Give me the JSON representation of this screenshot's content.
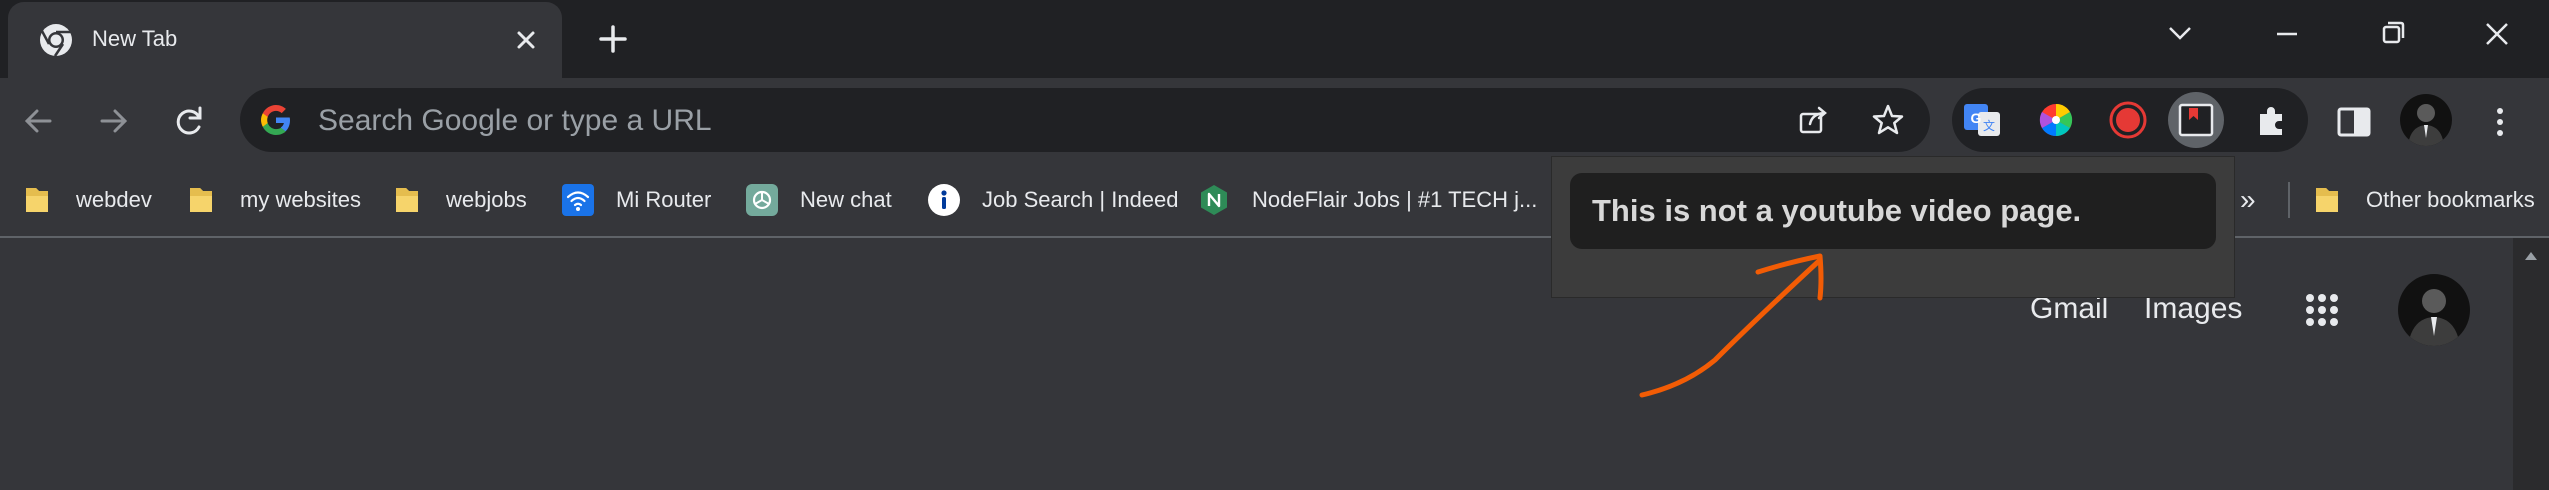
{
  "window": {
    "tab_title": "New Tab"
  },
  "omnibox": {
    "placeholder": "Search Google or type a URL"
  },
  "bookmarks": [
    {
      "label": "webdev",
      "icon": "folder-icon"
    },
    {
      "label": "my websites",
      "icon": "folder-icon"
    },
    {
      "label": "webjobs",
      "icon": "folder-icon"
    },
    {
      "label": "Mi Router",
      "icon": "wifi-icon"
    },
    {
      "label": "New chat",
      "icon": "chatgpt-icon"
    },
    {
      "label": "Job Search | Indeed",
      "icon": "indeed-icon"
    },
    {
      "label": "NodeFlair Jobs | #1 TECH j...",
      "icon": "nodeflair-icon"
    }
  ],
  "bookmarks_overflow": "»",
  "other_bookmarks": "Other bookmarks",
  "page": {
    "gmail": "Gmail",
    "images": "Images"
  },
  "popup": {
    "message": "This is not a youtube video page."
  },
  "colors": {
    "frame": "#202124",
    "toolbar": "#35363a",
    "text": "#e8eaed",
    "annotation": "#f25c05",
    "folder": "#f6d46b"
  }
}
